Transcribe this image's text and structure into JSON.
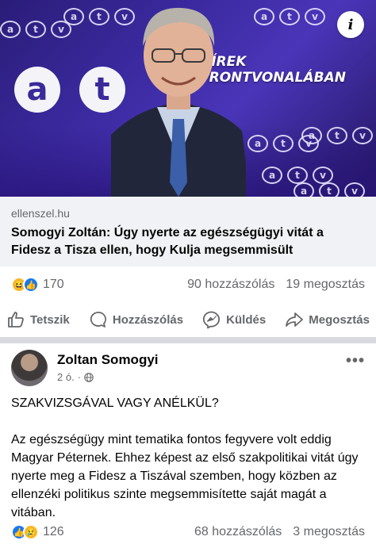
{
  "link_preview": {
    "image_caption_line1": "HÍREK",
    "image_caption_line2": "FRONTVONALÁBAN",
    "logo_letters": [
      "a",
      "t",
      "v"
    ],
    "domain": "ellenszel.hu",
    "title": "Somogyi Zoltán: Úgy nyerte az egészségügyi vitát a Fidesz a Tisza ellen, hogy Kulja megsemmisült"
  },
  "share_stats": {
    "reactions": [
      "haha",
      "like"
    ],
    "reaction_count": "170",
    "comments": "90 hozzászólás",
    "shares": "19 megosztás"
  },
  "actions": [
    {
      "label": "Tetszik",
      "icon": "thumbs-up-icon"
    },
    {
      "label": "Hozzászólás",
      "icon": "comment-icon"
    },
    {
      "label": "Küldés",
      "icon": "messenger-icon"
    },
    {
      "label": "Megosztás",
      "icon": "share-icon"
    }
  ],
  "post": {
    "author": "Zoltan Somogyi",
    "time": "2 ó.",
    "audience_icon": "globe-icon",
    "more_label": "•••",
    "paragraphs": [
      "SZAKVIZSGÁVAL VAGY ANÉLKÜL?",
      "Az egészségügy mint tematika fontos fegyvere volt eddig Magyar Péternek. Ehhez képest az első szakpolitikai vitát úgy nyerte meg a Fidesz a Tiszával szemben, hogy közben az ellenzéki politikus szinte megsemmisítette saját magát a vitában."
    ]
  },
  "post_stats": {
    "reactions": [
      "like",
      "sad"
    ],
    "reaction_count": "126",
    "comments": "68 hozzászólás",
    "shares": "3 megosztás"
  },
  "colors": {
    "accent": "#1877f2",
    "muted_text": "#65676b",
    "link_bg": "#f0f2f5",
    "hero_purple": "#3b2aa0"
  }
}
